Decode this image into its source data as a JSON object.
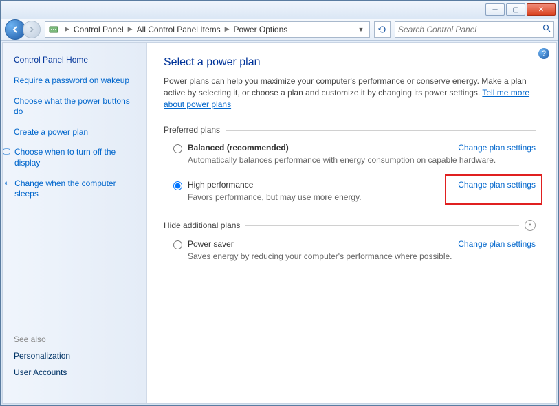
{
  "window": {
    "minimize": "─",
    "maximize": "▢",
    "close": "✕"
  },
  "breadcrumb": {
    "items": [
      "Control Panel",
      "All Control Panel Items",
      "Power Options"
    ]
  },
  "search": {
    "placeholder": "Search Control Panel"
  },
  "sidebar": {
    "home": "Control Panel Home",
    "links": [
      {
        "label": "Require a password on wakeup",
        "icon": ""
      },
      {
        "label": "Choose what the power buttons do",
        "icon": ""
      },
      {
        "label": "Create a power plan",
        "icon": ""
      },
      {
        "label": "Choose when to turn off the display",
        "icon": "🖵"
      },
      {
        "label": "Change when the computer sleeps",
        "icon": "◐"
      }
    ],
    "seealso_title": "See also",
    "seealso": [
      "Personalization",
      "User Accounts"
    ]
  },
  "main": {
    "title": "Select a power plan",
    "intro_text": "Power plans can help you maximize your computer's performance or conserve energy. Make a plan active by selecting it, or choose a plan and customize it by changing its power settings. ",
    "intro_link": "Tell me more about power plans",
    "preferred_label": "Preferred plans",
    "hide_label": "Hide additional plans",
    "change_link": "Change plan settings",
    "plans_preferred": [
      {
        "name": "Balanced (recommended)",
        "desc": "Automatically balances performance with energy consumption on capable hardware.",
        "selected": false,
        "bold": true
      },
      {
        "name": "High performance",
        "desc": "Favors performance, but may use more energy.",
        "selected": true,
        "bold": false
      }
    ],
    "plans_additional": [
      {
        "name": "Power saver",
        "desc": "Saves energy by reducing your computer's performance where possible.",
        "selected": false,
        "bold": false
      }
    ]
  }
}
